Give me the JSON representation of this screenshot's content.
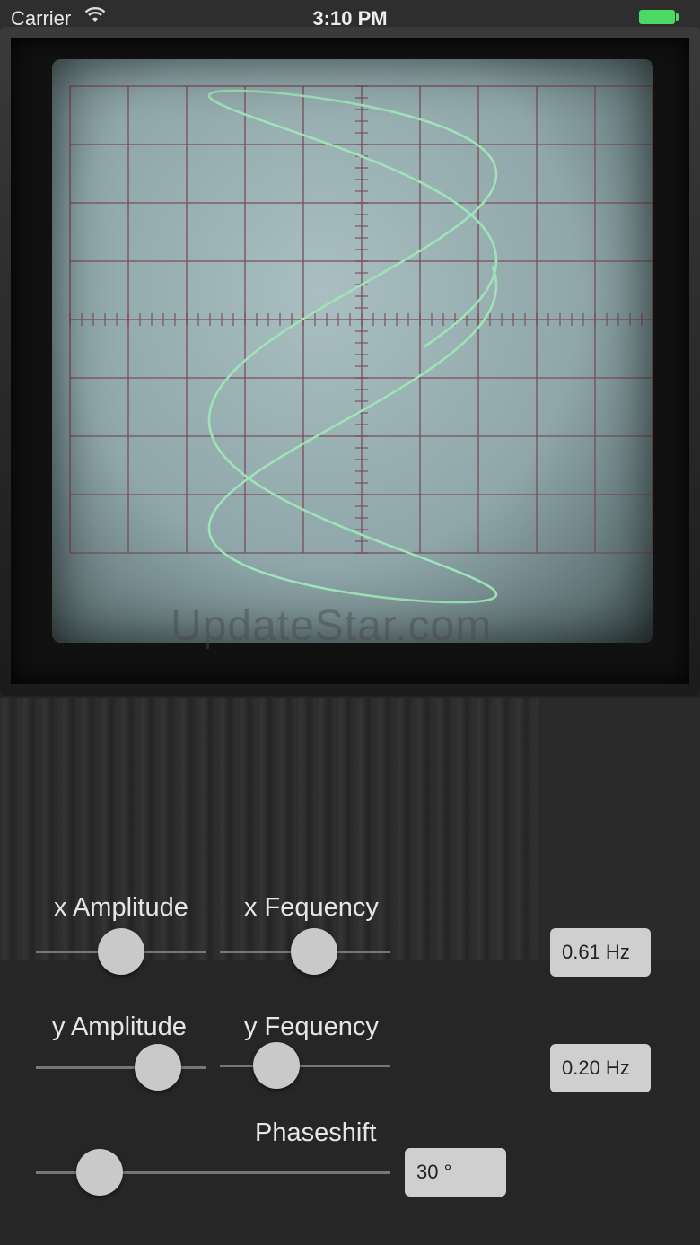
{
  "status_bar": {
    "carrier": "Carrier",
    "time": "3:10 PM"
  },
  "watermark": "UpdateStar.com",
  "controls": {
    "x_amplitude": {
      "label": "x Amplitude",
      "level": 0.5
    },
    "x_frequency": {
      "label": "x Fequency",
      "level": 0.57,
      "value": "0.61 Hz"
    },
    "y_amplitude": {
      "label": "y Amplitude",
      "level": 0.8
    },
    "y_frequency": {
      "label": "y Fequency",
      "level": 0.27,
      "value": "0.20 Hz"
    },
    "phaseshift": {
      "label": "Phaseshift",
      "level": 0.13,
      "value": "30 °"
    }
  },
  "colors": {
    "trace": "#9fe3b8",
    "grid": "#7a4b55",
    "thumb": "#c9c9c9",
    "battery": "#4cd964"
  }
}
